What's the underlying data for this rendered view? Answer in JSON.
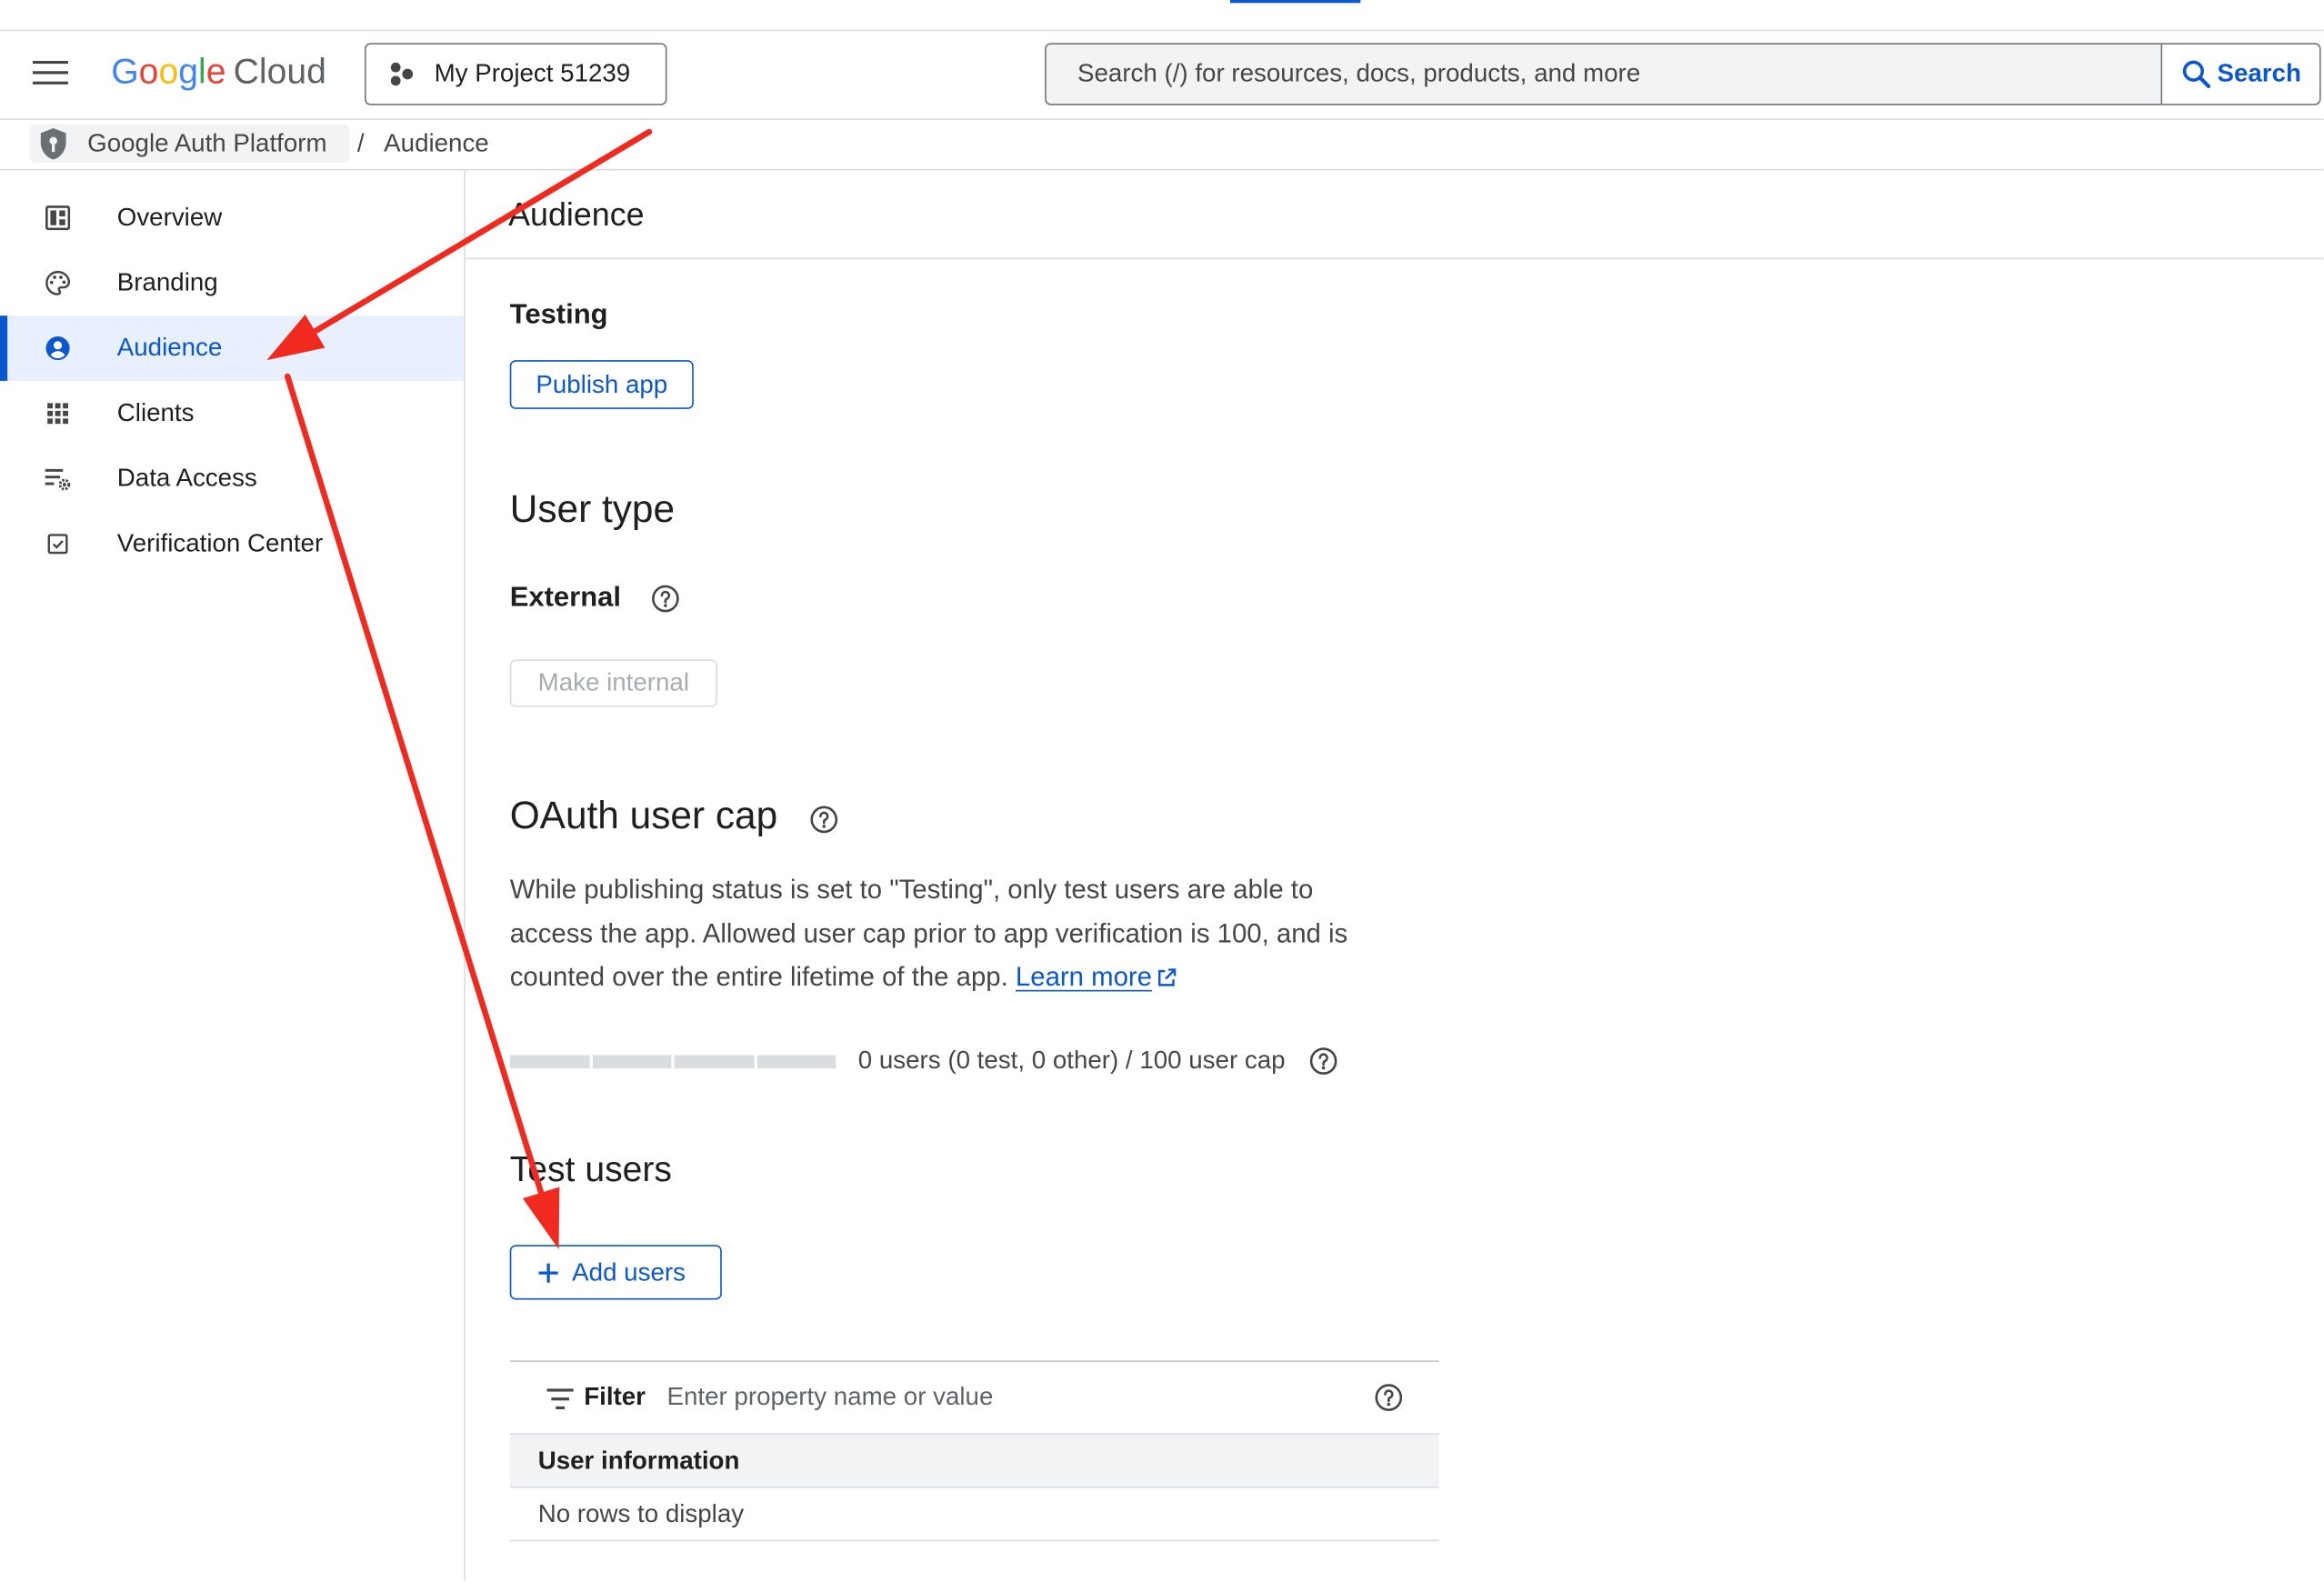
{
  "colors": {
    "accent": "#0b57d0",
    "selected_bg": "#e8f0fe",
    "annotation": "#f02a1e",
    "text_primary": "#1f1f1f",
    "text_secondary": "#444746",
    "border": "#dadce0",
    "surface": "#f1f3f4"
  },
  "header": {
    "menu_icon": "menu-icon",
    "brand": {
      "name": "Google",
      "product": "Cloud",
      "letter_colors": [
        "#4285F4",
        "#EA4335",
        "#FBBC05",
        "#4285F4",
        "#34A853",
        "#EA4335"
      ]
    },
    "project": {
      "icon": "project-icon",
      "label": "My Project 51239"
    },
    "search": {
      "placeholder": "Search (/) for resources, docs, products, and more",
      "button_label": "Search",
      "icon": "search-icon"
    }
  },
  "breadcrumb": {
    "product_icon": "shield-icon",
    "product": "Google Auth Platform",
    "separator": "/",
    "current": "Audience"
  },
  "sidebar": {
    "items": [
      {
        "label": "Overview",
        "icon": "dashboard-icon",
        "selected": false
      },
      {
        "label": "Branding",
        "icon": "palette-icon",
        "selected": false
      },
      {
        "label": "Audience",
        "icon": "account-circle-icon",
        "selected": true
      },
      {
        "label": "Clients",
        "icon": "apps-grid-icon",
        "selected": false
      },
      {
        "label": "Data Access",
        "icon": "data-access-icon",
        "selected": false
      },
      {
        "label": "Verification Center",
        "icon": "verification-icon",
        "selected": false
      }
    ]
  },
  "main": {
    "title": "Audience",
    "publishing": {
      "status": "Testing",
      "publish_button": "Publish app"
    },
    "user_type": {
      "heading": "User type",
      "value": "External",
      "make_internal_button": "Make internal"
    },
    "cap": {
      "heading": "OAuth user cap",
      "description_lines": [
        "While publishing status is set to \"Testing\", only test users are able to",
        "access the app. Allowed user cap prior to app verification is 100, and is",
        "counted over the entire lifetime of the app."
      ],
      "learn_more": "Learn more",
      "usage_text": "0 users (0 test, 0 other) / 100 user cap",
      "usage": {
        "used": 0,
        "cap": 100
      }
    },
    "test_users": {
      "heading": "Test users",
      "add_button": "Add users",
      "filter_label": "Filter",
      "filter_placeholder": "Enter property name or value",
      "column": "User information",
      "empty": "No rows to display"
    }
  }
}
